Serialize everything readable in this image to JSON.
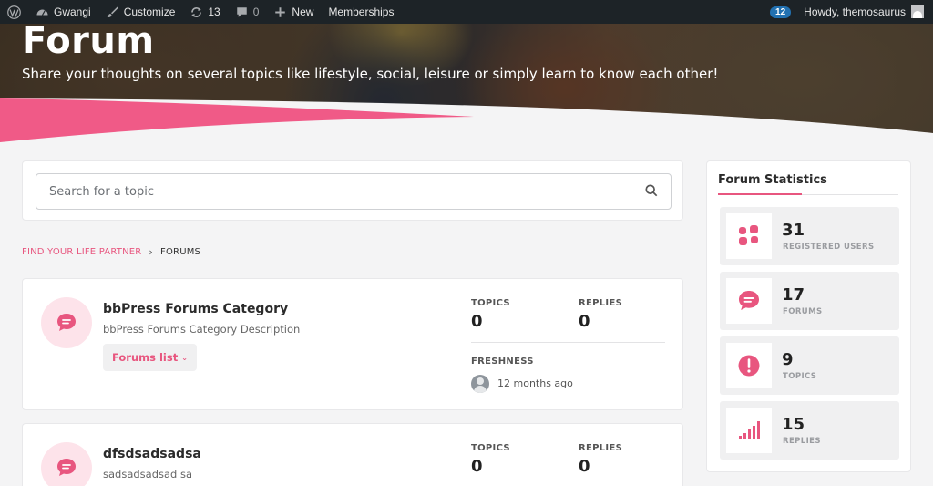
{
  "adminbar": {
    "site_name": "Gwangi",
    "customize": "Customize",
    "updates_count": "13",
    "comments_count": "0",
    "new_label": "New",
    "memberships": "Memberships",
    "notif_badge": "12",
    "greeting": "Howdy, themosaurus"
  },
  "hero": {
    "title": "Forum",
    "subtitle": "Share your thoughts on several topics like lifestyle, social, leisure or simply learn to know each other!"
  },
  "search": {
    "placeholder": "Search for a topic"
  },
  "breadcrumb": {
    "home": "FIND YOUR LIFE PARTNER",
    "separator": "›",
    "current": "FORUMS"
  },
  "forums": [
    {
      "title": "bbPress Forums Category",
      "description": "bbPress Forums Category Description",
      "button": "Forums list",
      "topics_label": "TOPICS",
      "topics": "0",
      "replies_label": "REPLIES",
      "replies": "0",
      "freshness_label": "FRESHNESS",
      "freshness": "12 months ago"
    },
    {
      "title": "dfsdsadsadsa",
      "description": "sadsadsadsad sa",
      "topics_label": "TOPICS",
      "topics": "0",
      "replies_label": "REPLIES",
      "replies": "0"
    }
  ],
  "sidebar": {
    "title": "Forum Statistics",
    "stats": [
      {
        "value": "31",
        "label": "REGISTERED USERS",
        "icon": "users-icon"
      },
      {
        "value": "17",
        "label": "FORUMS",
        "icon": "chat-bubble-icon"
      },
      {
        "value": "9",
        "label": "TOPICS",
        "icon": "alert-icon"
      },
      {
        "value": "15",
        "label": "REPLIES",
        "icon": "signal-bars-icon"
      }
    ]
  },
  "colors": {
    "accent": "#e8567f",
    "accent_light": "#fde3ea",
    "adminbar_bg": "#1d2327",
    "badge_blue": "#2271b1"
  }
}
